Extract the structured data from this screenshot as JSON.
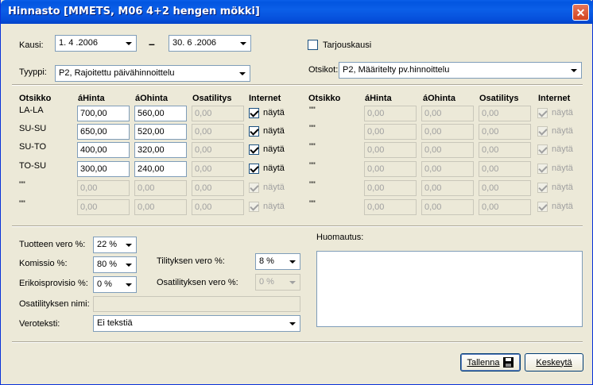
{
  "window": {
    "title": "Hinnasto [MMETS, M06 4+2 hengen mökki]"
  },
  "top": {
    "kausi_label": "Kausi:",
    "start_date": "1. 4 .2006",
    "dash": "–",
    "end_date": "30. 6 .2006",
    "tarjous_label": "Tarjouskausi",
    "tyyppi_label": "Tyyppi:",
    "tyyppi_value": "P2, Rajoitettu päivähinnoittelu",
    "otsikot_label": "Otsikot:",
    "otsikot_value": "P2, Määritelty pv.hinnoittelu"
  },
  "headers": {
    "otsikko": "Otsikko",
    "ahinta": "áHinta",
    "aohinta": "áOhinta",
    "osatilitys": "Osatilitys",
    "internet": "Internet"
  },
  "left_rows": [
    {
      "otsikko": "LA-LA",
      "ahinta": "700,00",
      "aohinta": "560,00",
      "osatilitys": "0,00",
      "internet_label": "näytä",
      "checked": true,
      "enabled": true
    },
    {
      "otsikko": "SU-SU",
      "ahinta": "650,00",
      "aohinta": "520,00",
      "osatilitys": "0,00",
      "internet_label": "näytä",
      "checked": true,
      "enabled": true
    },
    {
      "otsikko": "SU-TO",
      "ahinta": "400,00",
      "aohinta": "320,00",
      "osatilitys": "0,00",
      "internet_label": "näytä",
      "checked": true,
      "enabled": true
    },
    {
      "otsikko": "TO-SU",
      "ahinta": "300,00",
      "aohinta": "240,00",
      "osatilitys": "0,00",
      "internet_label": "näytä",
      "checked": true,
      "enabled": true
    },
    {
      "otsikko": "\"\"",
      "ahinta": "0,00",
      "aohinta": "0,00",
      "osatilitys": "0,00",
      "internet_label": "näytä",
      "checked": true,
      "enabled": false
    },
    {
      "otsikko": "\"\"",
      "ahinta": "0,00",
      "aohinta": "0,00",
      "osatilitys": "0,00",
      "internet_label": "näytä",
      "checked": true,
      "enabled": false
    }
  ],
  "right_rows": [
    {
      "otsikko": "\"\"",
      "ahinta": "0,00",
      "aohinta": "0,00",
      "osatilitys": "0,00",
      "internet_label": "näytä"
    },
    {
      "otsikko": "\"\"",
      "ahinta": "0,00",
      "aohinta": "0,00",
      "osatilitys": "0,00",
      "internet_label": "näytä"
    },
    {
      "otsikko": "\"\"",
      "ahinta": "0,00",
      "aohinta": "0,00",
      "osatilitys": "0,00",
      "internet_label": "näytä"
    },
    {
      "otsikko": "\"\"",
      "ahinta": "0,00",
      "aohinta": "0,00",
      "osatilitys": "0,00",
      "internet_label": "näytä"
    },
    {
      "otsikko": "\"\"",
      "ahinta": "0,00",
      "aohinta": "0,00",
      "osatilitys": "0,00",
      "internet_label": "näytä"
    },
    {
      "otsikko": "\"\"",
      "ahinta": "0,00",
      "aohinta": "0,00",
      "osatilitys": "0,00",
      "internet_label": "näytä"
    }
  ],
  "bottom": {
    "tuotteen_vero_label": "Tuotteen vero %:",
    "tuotteen_vero_value": "22 %",
    "komissio_label": "Komissio %:",
    "komissio_value": "80 %",
    "erikoisprovisio_label": "Erikoisprovisio %:",
    "erikoisprovisio_value": "0 %",
    "tilityksen_vero_label": "Tilityksen vero %:",
    "tilityksen_vero_value": "8 %",
    "osatilityksen_vero_label": "Osatilityksen vero %:",
    "osatilityksen_vero_value": "0 %",
    "osatilityksen_nimi_label": "Osatilityksen nimi:",
    "osatilityksen_nimi_value": "",
    "veroteksti_label": "Veroteksti:",
    "veroteksti_value": "Ei tekstiä",
    "huomautus_label": "Huomautus:"
  },
  "buttons": {
    "save": "Tallenna",
    "cancel": "Keskeytä"
  }
}
